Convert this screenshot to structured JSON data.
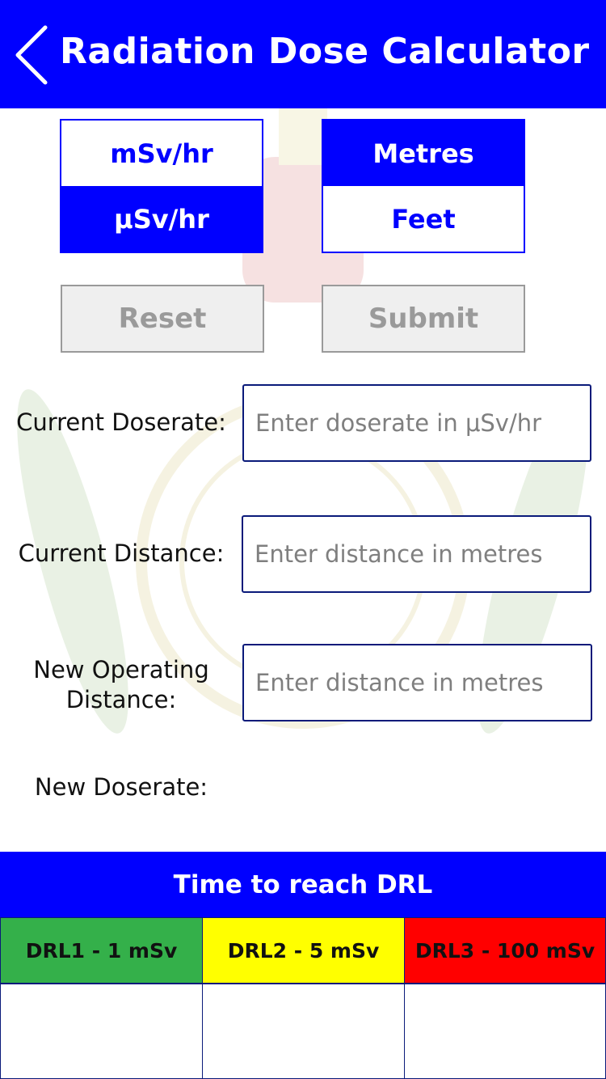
{
  "header": {
    "title": "Radiation Dose Calculator",
    "back_icon": "chevron-left-icon"
  },
  "dose_unit": {
    "options": [
      "mSv/hr",
      "μSv/hr"
    ],
    "selected": "μSv/hr"
  },
  "distance_unit": {
    "options": [
      "Metres",
      "Feet"
    ],
    "selected": "Metres"
  },
  "actions": {
    "reset_label": "Reset",
    "submit_label": "Submit"
  },
  "form": {
    "current_doserate": {
      "label": "Current Doserate:",
      "placeholder": "Enter doserate in μSv/hr",
      "value": ""
    },
    "current_distance": {
      "label": "Current Distance:",
      "placeholder": "Enter distance in metres",
      "value": ""
    },
    "new_distance": {
      "label_line1": "New Operating",
      "label_line2": "Distance:",
      "placeholder": "Enter distance in metres",
      "value": ""
    },
    "new_doserate": {
      "label": "New Doserate:",
      "value": ""
    }
  },
  "drl": {
    "title": "Time to reach DRL",
    "levels": [
      {
        "label": "DRL1 - 1 mSv",
        "color": "#34b04a",
        "value": ""
      },
      {
        "label": "DRL2 - 5 mSv",
        "color": "#ffff00",
        "value": ""
      },
      {
        "label": "DRL3 - 100 mSv",
        "color": "#ff0000",
        "value": ""
      }
    ]
  },
  "colors": {
    "primary": "#0000ff",
    "field_border": "#0a1a7a",
    "disabled_text": "#9a9a9a"
  }
}
